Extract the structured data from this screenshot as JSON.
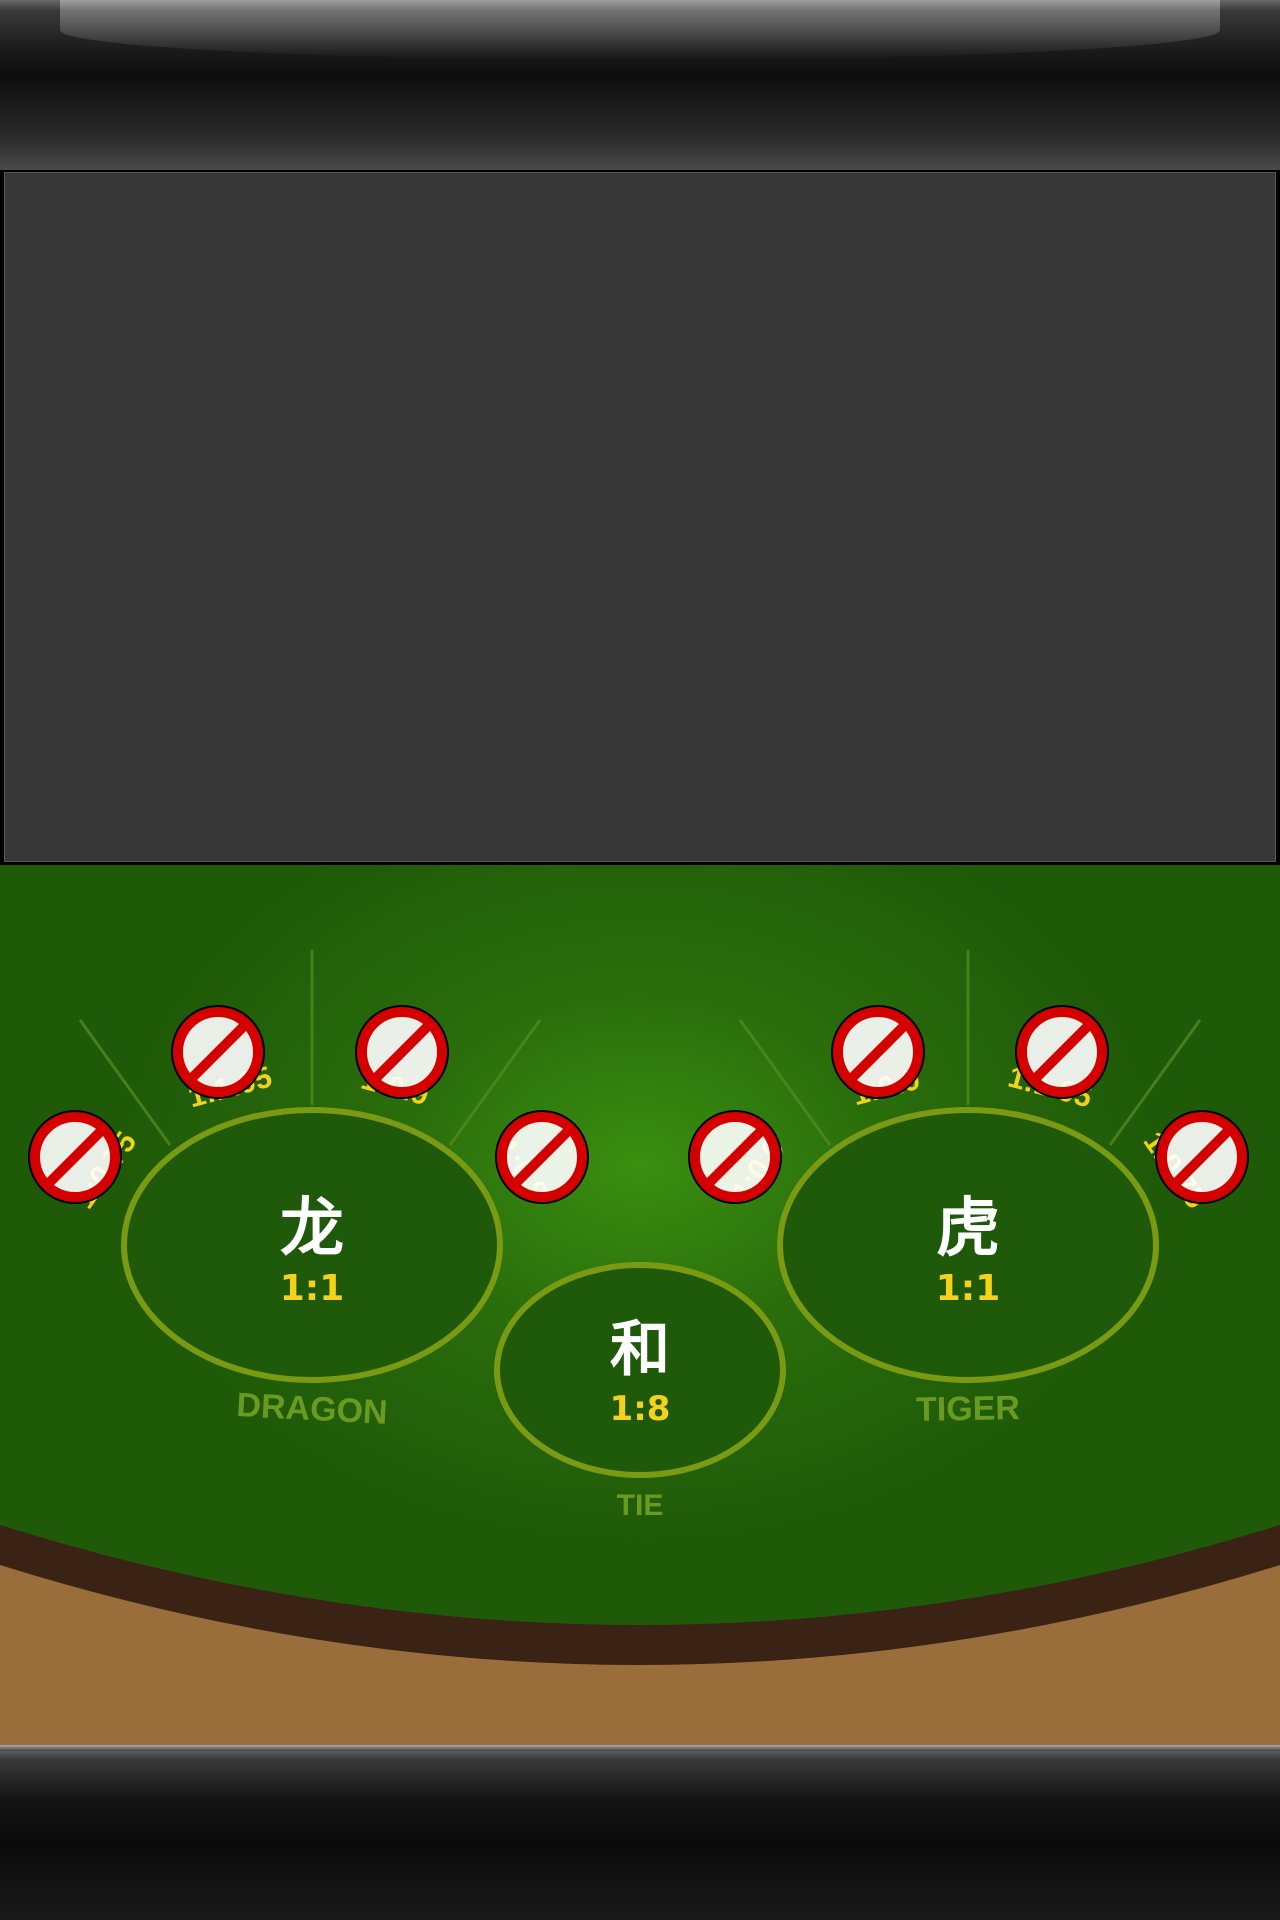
{
  "dragon": {
    "title": "龙",
    "odds": "1:1",
    "label": "DRAGON"
  },
  "tie": {
    "title": "和",
    "odds": "1:8",
    "label": "TIE"
  },
  "tiger": {
    "title": "虎",
    "odds": "1:1",
    "label": "TIGER"
  },
  "side_bets_left": [
    {
      "odds": "1:0.75",
      "icon": "no-bet-icon"
    },
    {
      "odds": "1:1.05",
      "icon": "no-bet-icon"
    },
    {
      "odds": "1:0.9",
      "icon": "no-bet-icon"
    },
    {
      "odds": "1:0.9",
      "icon": "no-bet-icon"
    }
  ],
  "side_bets_right": [
    {
      "odds": "1:0.9",
      "icon": "no-bet-icon"
    },
    {
      "odds": "1:0.9",
      "icon": "no-bet-icon"
    },
    {
      "odds": "1:1.05",
      "icon": "no-bet-icon"
    },
    {
      "odds": "1:0.75",
      "icon": "no-bet-icon"
    }
  ],
  "colors": {
    "felt": "#2a6e0c",
    "odds": "#f4d21a",
    "ring": "#7a9a14",
    "no_bet": "#d40000"
  }
}
